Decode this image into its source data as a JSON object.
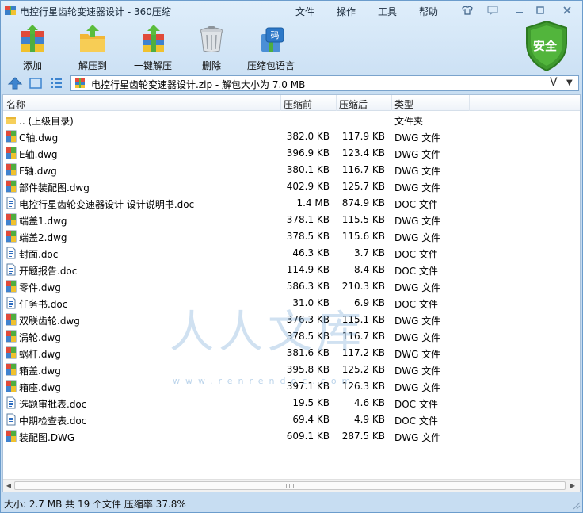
{
  "window": {
    "title": "电控行星齿轮变速器设计 - 360压缩",
    "menu": [
      "文件",
      "操作",
      "工具",
      "帮助"
    ]
  },
  "toolbar": {
    "add": "添加",
    "extract_to": "解压到",
    "one_click_extract": "一键解压",
    "delete": "删除",
    "archive_password": "压缩包语言"
  },
  "security_badge": "安全",
  "address": {
    "path": "电控行星齿轮变速器设计.zip - 解包大小为 7.0 MB",
    "v_label": "V"
  },
  "columns": {
    "name": "名称",
    "size": "压缩前",
    "packed": "压缩后",
    "type": "类型"
  },
  "files": [
    {
      "name": ".. (上级目录)",
      "size": "",
      "packed": "",
      "type": "文件夹",
      "icon": "folder-icon"
    },
    {
      "name": "C轴.dwg",
      "size": "382.0 KB",
      "packed": "117.9 KB",
      "type": "DWG 文件",
      "icon": "dwg-icon"
    },
    {
      "name": "E轴.dwg",
      "size": "396.9 KB",
      "packed": "123.4 KB",
      "type": "DWG 文件",
      "icon": "dwg-icon"
    },
    {
      "name": "F轴.dwg",
      "size": "380.1 KB",
      "packed": "116.7 KB",
      "type": "DWG 文件",
      "icon": "dwg-icon"
    },
    {
      "name": "部件装配图.dwg",
      "size": "402.9 KB",
      "packed": "125.7 KB",
      "type": "DWG 文件",
      "icon": "dwg-icon"
    },
    {
      "name": "电控行星齿轮变速器设计 设计说明书.doc",
      "size": "1.4 MB",
      "packed": "874.9 KB",
      "type": "DOC 文件",
      "icon": "doc-icon"
    },
    {
      "name": "端盖1.dwg",
      "size": "378.1 KB",
      "packed": "115.5 KB",
      "type": "DWG 文件",
      "icon": "dwg-icon"
    },
    {
      "name": "端盖2.dwg",
      "size": "378.5 KB",
      "packed": "115.6 KB",
      "type": "DWG 文件",
      "icon": "dwg-icon"
    },
    {
      "name": "封面.doc",
      "size": "46.3 KB",
      "packed": "3.7 KB",
      "type": "DOC 文件",
      "icon": "doc-icon"
    },
    {
      "name": "开题报告.doc",
      "size": "114.9 KB",
      "packed": "8.4 KB",
      "type": "DOC 文件",
      "icon": "doc-icon"
    },
    {
      "name": "零件.dwg",
      "size": "586.3 KB",
      "packed": "210.3 KB",
      "type": "DWG 文件",
      "icon": "dwg-icon"
    },
    {
      "name": "任务书.doc",
      "size": "31.0 KB",
      "packed": "6.9 KB",
      "type": "DOC 文件",
      "icon": "doc-icon"
    },
    {
      "name": "双联齿轮.dwg",
      "size": "376.3 KB",
      "packed": "115.1 KB",
      "type": "DWG 文件",
      "icon": "dwg-icon"
    },
    {
      "name": "涡轮.dwg",
      "size": "378.5 KB",
      "packed": "116.7 KB",
      "type": "DWG 文件",
      "icon": "dwg-icon"
    },
    {
      "name": "蜗杆.dwg",
      "size": "381.6 KB",
      "packed": "117.2 KB",
      "type": "DWG 文件",
      "icon": "dwg-icon"
    },
    {
      "name": "箱盖.dwg",
      "size": "395.8 KB",
      "packed": "125.2 KB",
      "type": "DWG 文件",
      "icon": "dwg-icon"
    },
    {
      "name": "箱座.dwg",
      "size": "397.1 KB",
      "packed": "126.3 KB",
      "type": "DWG 文件",
      "icon": "dwg-icon"
    },
    {
      "name": "选题审批表.doc",
      "size": "19.5 KB",
      "packed": "4.6 KB",
      "type": "DOC 文件",
      "icon": "doc-icon"
    },
    {
      "name": "中期检查表.doc",
      "size": "69.4 KB",
      "packed": "4.9 KB",
      "type": "DOC 文件",
      "icon": "doc-icon"
    },
    {
      "name": "装配图.DWG",
      "size": "609.1 KB",
      "packed": "287.5 KB",
      "type": "DWG 文件",
      "icon": "dwg-icon"
    }
  ],
  "watermark": {
    "text": "人人文库",
    "url": "www.renrendoc.com"
  },
  "status": "大小: 2.7 MB 共 19 个文件 压缩率 37.8%"
}
